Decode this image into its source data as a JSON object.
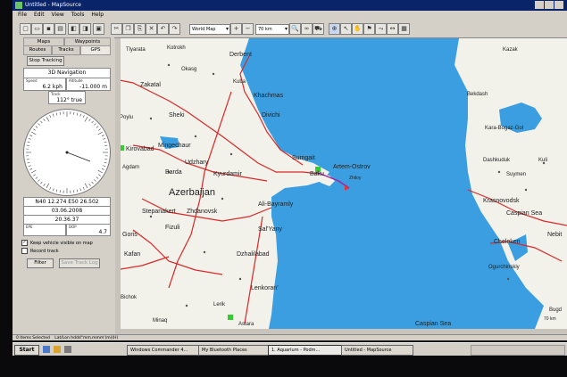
{
  "window": {
    "title": "Untitled - MapSource"
  },
  "menu": [
    "File",
    "Edit",
    "View",
    "Tools",
    "Help"
  ],
  "toolbar": {
    "map_select": "World Map",
    "zoom_select": "70 km"
  },
  "panel": {
    "tabs_top": [
      "Maps",
      "Waypoints"
    ],
    "tabs_bottom": [
      "Routes",
      "Tracks",
      "GPS"
    ],
    "stop_tracking": "Stop Tracking",
    "nav_header": "3D Navigation",
    "speed_label": "Speed",
    "speed_value": "6.2 kph",
    "altitude_label": "Altitude",
    "altitude_value": "-11.000 m",
    "track_label": "Track",
    "track_value": "112° true",
    "position": "N40 12.274 E50 26.502",
    "date": "03.06.2008",
    "time": "20.36.37",
    "epe_label": "EPE",
    "dop_label": "DOP",
    "dop_value": "4.7",
    "keep_visible": "Keep vehicle visible on map",
    "record_track": "Record track",
    "filter_btn": "Filter",
    "save_btn": "Save Track Log"
  },
  "map": {
    "country": "Azerbaijan",
    "sea": "Caspian Sea",
    "sea_right": "Caspian Sea",
    "scale": "70 km",
    "cities": {
      "tlyarata": "Tlyarata",
      "kotrokh": "Kotrokh",
      "derbent": "Derbent",
      "okasg": "Okasg",
      "zakatal": "Zakatal",
      "kuba": "Kuba",
      "khachmas": "Khachmas",
      "divichi": "Divichi",
      "sheki": "Sheki",
      "mingechaur": "Mingechaur",
      "kirovabad": "Kirovabad",
      "udzhary": "Udzhary",
      "sumgait": "Sumgait",
      "baku": "Baku",
      "artem": "Artem-Ostrov",
      "barda": "Barda",
      "kyurdamir": "Kyurdamir",
      "stepanakert": "Stepanakert",
      "zhdanovsk": "Zhdanovsk",
      "alibayramly": "Ali-Bayramly",
      "goris": "Goris",
      "fizuli": "Fizuli",
      "salyany": "Sal'Yany",
      "kafan": "Kafan",
      "dzhalilabad": "Dzhalilabad",
      "lenkoran": "Lenkoran'",
      "minaq": "Minaq",
      "astara": "Astara",
      "bekdash": "Bekdash",
      "karabogaz": "Kara-Bogaz-Gol",
      "dashkuduk": "Dashkuduk",
      "krasnovodsk": "Krasnovodsk",
      "cheleken": "Cheleken",
      "ogurchinskiy": "Ogurchinskiy",
      "nebit": "Nebit",
      "kazak": "Kazak",
      "kuli": "Kuli",
      "suymen": "Suymen",
      "bugd": "Bugd",
      "zhiloy": "Zhiloy",
      "poylu": "Poylu",
      "agdam": "Agdam",
      "bichok": "Bichok",
      "lerik": "Lerik"
    }
  },
  "status": {
    "left": "0 Items Selected",
    "coords": "Lat/Lon hddd°mm.mmm'(m)(H)"
  },
  "taskbar": {
    "start": "Start",
    "tasks": [
      "Windows Commander 4...",
      "My Bluetooth Places",
      "1. Aquarium - Podm...",
      "Untitled - MapSource"
    ]
  },
  "colors": {
    "sea": "#3a9ee0",
    "land": "#f2f1ea",
    "road": "#d82a2a",
    "title": "#0a246a"
  }
}
